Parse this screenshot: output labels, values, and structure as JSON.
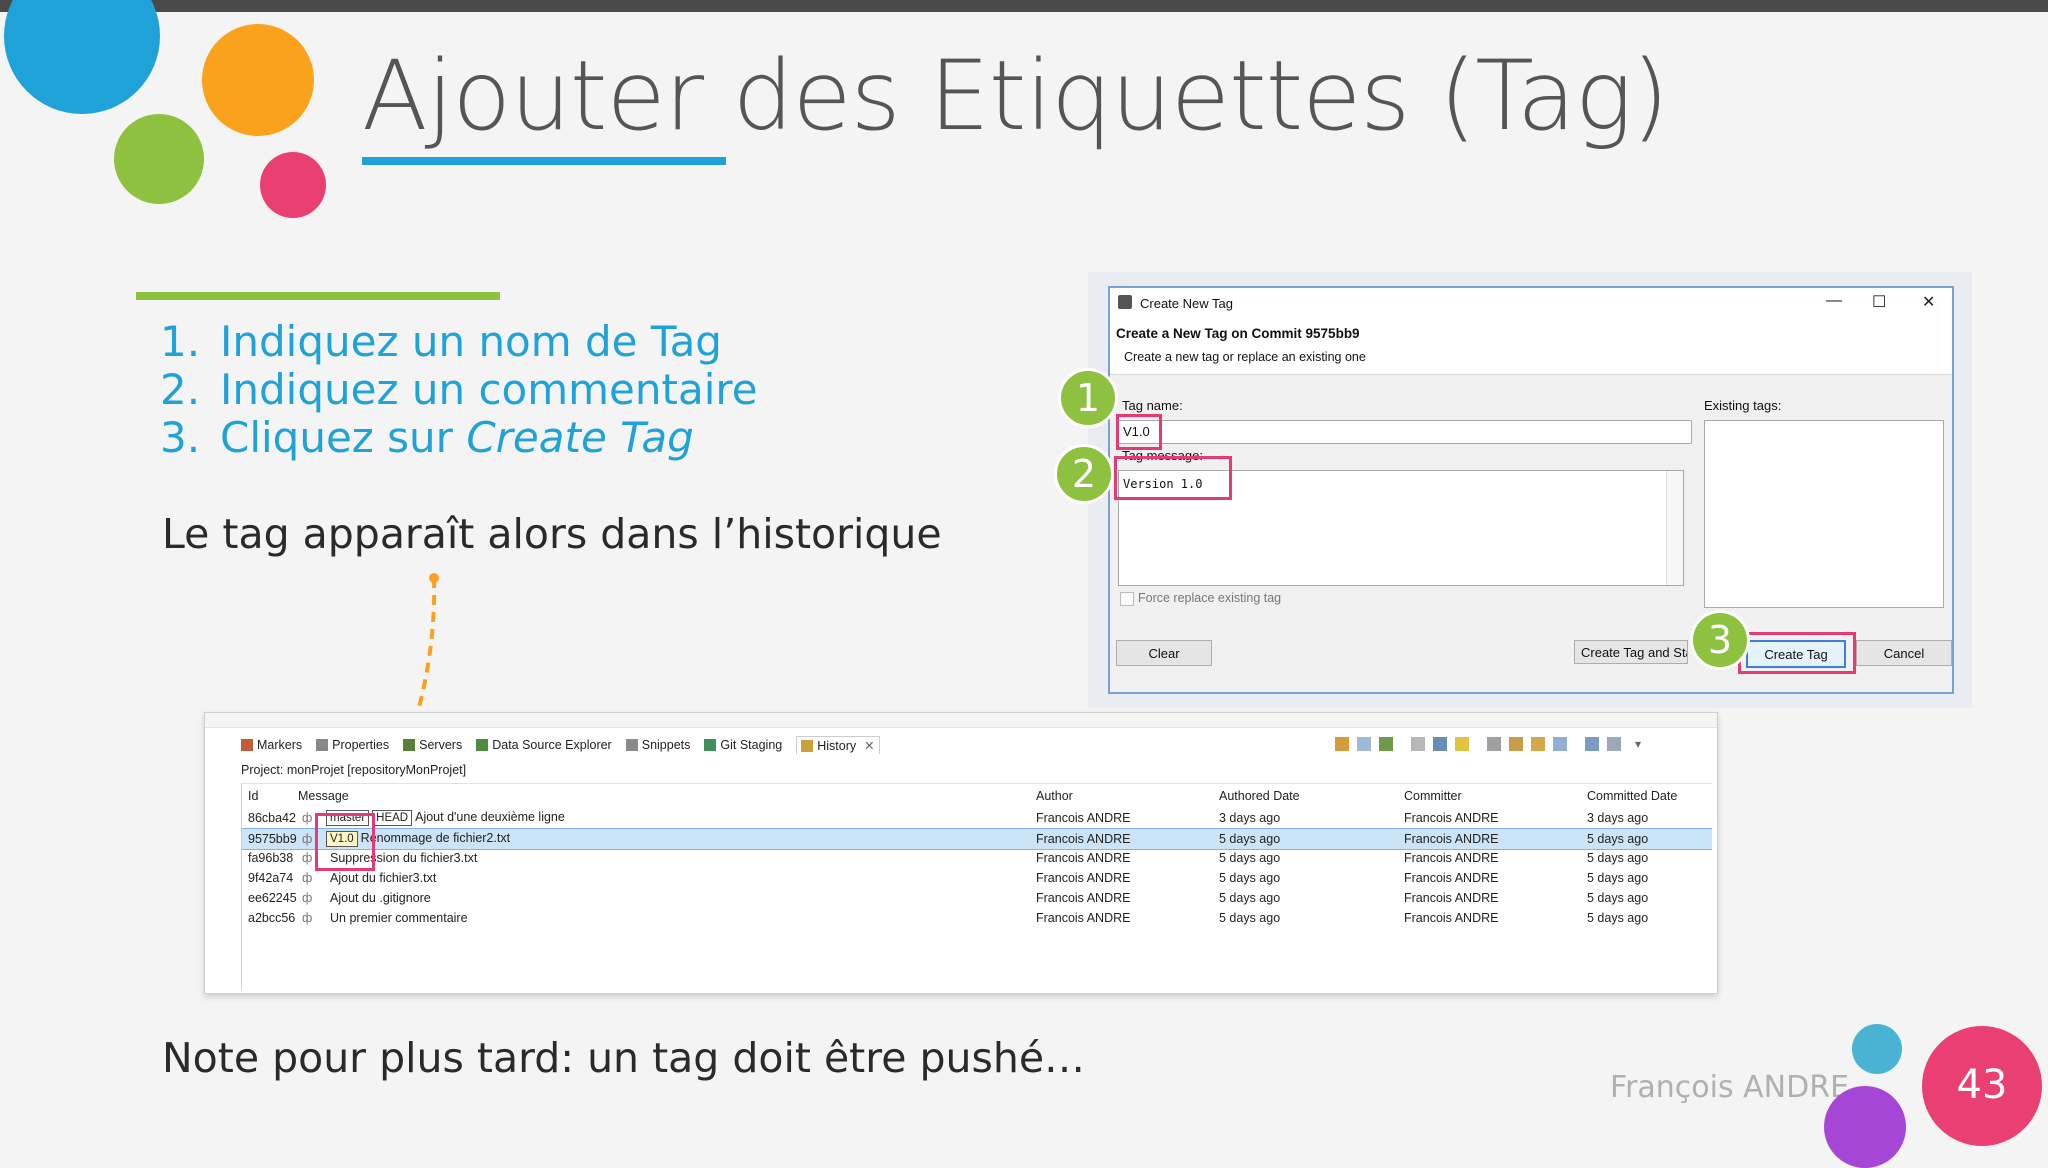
{
  "slide": {
    "title": "Ajouter des Etiquettes (Tag)",
    "steps": [
      {
        "num": "1.",
        "text": "Indiquez un nom de Tag"
      },
      {
        "num": "2.",
        "text": "Indiquez un commentaire"
      },
      {
        "num": "3.",
        "text_prefix": "Cliquez sur ",
        "text_em": "Create Tag"
      }
    ],
    "tag_appears_text": "Le tag apparaît alors dans l’historique",
    "note_text": "Note pour plus tard: un tag doit être pushé…",
    "author": "François ANDRE",
    "page_number": "43",
    "colors": {
      "blue": "#1fa2d8",
      "orange": "#fba21c",
      "green": "#8dc13f",
      "pink": "#ea3f73",
      "purple": "#a646d6",
      "light_blue": "#4ab3d4"
    }
  },
  "dialog": {
    "window_title": "Create New Tag",
    "heading": "Create a New Tag on Commit 9575bb9",
    "subheading": "Create a new tag or replace an existing one",
    "tag_name_label": "Tag name:",
    "tag_name_value": "V1.0",
    "tag_message_label": "Tag message:",
    "tag_message_value": "Version 1.0",
    "existing_tags_label": "Existing tags:",
    "force_replace_label": "Force replace existing tag",
    "buttons": {
      "clear": "Clear",
      "create_and_start": "Create Tag and Start",
      "create": "Create Tag",
      "cancel": "Cancel"
    },
    "badges": [
      "1",
      "2",
      "3"
    ],
    "window_controls": {
      "minimize": "—",
      "maximize": "☐",
      "close": "✕"
    }
  },
  "history": {
    "tabs": [
      "Markers",
      "Properties",
      "Servers",
      "Data Source Explorer",
      "Snippets",
      "Git Staging",
      "History"
    ],
    "project_line": "Project: monProjet [repositoryMonProjet]",
    "columns": [
      "Id",
      "Message",
      "Author",
      "Authored Date",
      "Committer",
      "Committed Date"
    ],
    "rows": [
      {
        "id": "86cba42",
        "labels": [
          "master",
          "HEAD"
        ],
        "message": "Ajout d'une deuxième ligne",
        "author": "Francois ANDRE",
        "authored": "3 days ago",
        "committer": "Francois ANDRE",
        "committed": "3 days ago"
      },
      {
        "id": "9575bb9",
        "labels": [
          "V1.0"
        ],
        "message": "Renommage de fichier2.txt",
        "author": "Francois ANDRE",
        "authored": "5 days ago",
        "committer": "Francois ANDRE",
        "committed": "5 days ago"
      },
      {
        "id": "fa96b38",
        "labels": [],
        "message": "Suppression du fichier3.txt",
        "author": "Francois ANDRE",
        "authored": "5 days ago",
        "committer": "Francois ANDRE",
        "committed": "5 days ago"
      },
      {
        "id": "9f42a74",
        "labels": [],
        "message": "Ajout du fichier3.txt",
        "author": "Francois ANDRE",
        "authored": "5 days ago",
        "committer": "Francois ANDRE",
        "committed": "5 days ago"
      },
      {
        "id": "ee62245",
        "labels": [],
        "message": "Ajout du .gitignore",
        "author": "Francois ANDRE",
        "authored": "5 days ago",
        "committer": "Francois ANDRE",
        "committed": "5 days ago"
      },
      {
        "id": "a2bcc56",
        "labels": [],
        "message": "Un premier commentaire",
        "author": "Francois ANDRE",
        "authored": "5 days ago",
        "committer": "Francois ANDRE",
        "committed": "5 days ago"
      }
    ]
  }
}
